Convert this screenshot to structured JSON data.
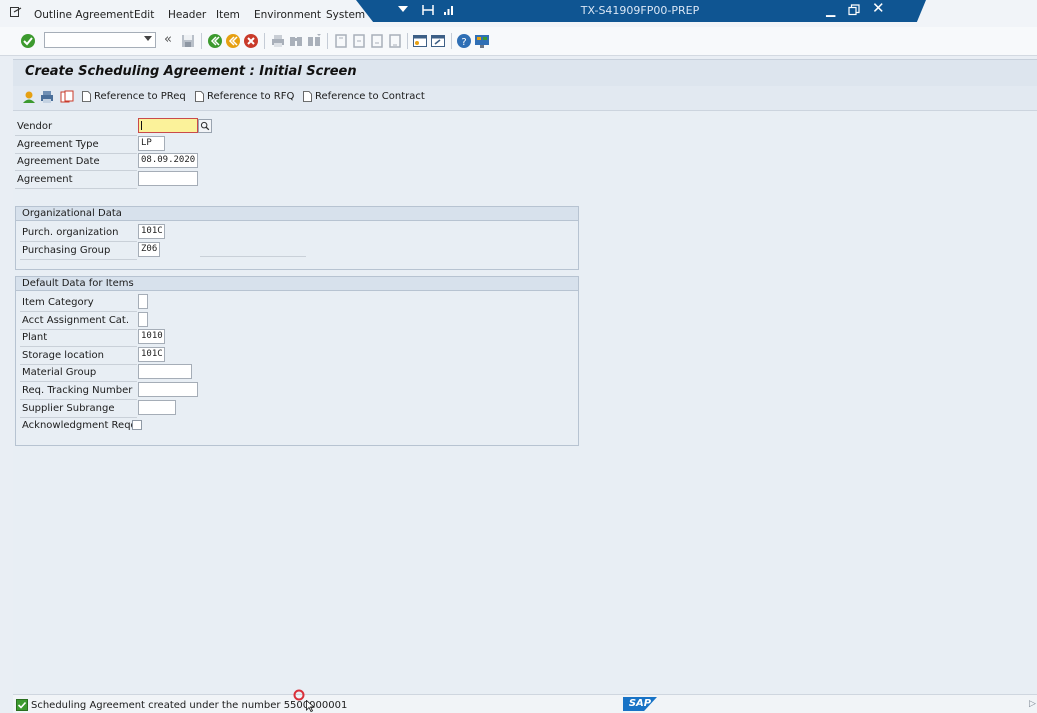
{
  "menu": {
    "items": [
      "Outline Agreement",
      "Edit",
      "Header",
      "Item",
      "Environment",
      "System"
    ]
  },
  "window": {
    "title": "TX-S41909FP00-PREP"
  },
  "screen": {
    "title": "Create Scheduling Agreement : Initial Screen"
  },
  "app_toolbar": {
    "ref_preq": "Reference to PReq",
    "ref_rfq": "Reference to RFQ",
    "ref_contract": "Reference to Contract"
  },
  "header_fields": {
    "vendor_label": "Vendor",
    "vendor_value": "",
    "agreement_type_label": "Agreement Type",
    "agreement_type_value": "LP",
    "agreement_date_label": "Agreement Date",
    "agreement_date_value": "08.09.2020",
    "agreement_label": "Agreement",
    "agreement_value": ""
  },
  "org_data": {
    "title": "Organizational Data",
    "purch_org_label": "Purch. organization",
    "purch_org_value": "101C",
    "purch_group_label": "Purchasing Group",
    "purch_group_value": "Z06"
  },
  "default_data": {
    "title": "Default Data for Items",
    "item_category_label": "Item Category",
    "item_category_value": "",
    "acct_assignment_label": "Acct Assignment Cat.",
    "acct_assignment_value": "",
    "plant_label": "Plant",
    "plant_value": "1010",
    "storage_location_label": "Storage location",
    "storage_location_value": "101C",
    "material_group_label": "Material Group",
    "material_group_value": "",
    "req_tracking_label": "Req. Tracking Number",
    "req_tracking_value": "",
    "supplier_subrange_label": "Supplier Subrange",
    "supplier_subrange_value": "",
    "ack_reqd_label": "Acknowledgment Reqd",
    "ack_reqd_checked": false
  },
  "status": {
    "message": "Scheduling Agreement created under the number 5500000001",
    "type": "success"
  },
  "brand": {
    "logo_text": "SAP",
    "accent": "#0f5592",
    "logo_blue": "#1873c6"
  }
}
